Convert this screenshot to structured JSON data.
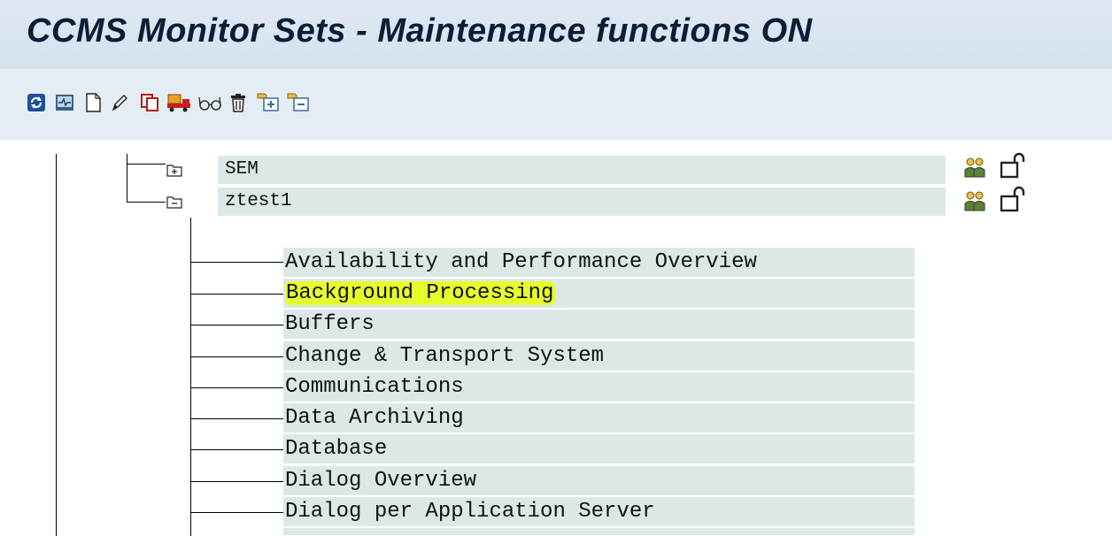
{
  "window": {
    "title": "CCMS Monitor Sets - Maintenance functions ON"
  },
  "toolbar": {
    "buttons": [
      {
        "icon": "refresh-icon"
      },
      {
        "icon": "monitor-icon"
      },
      {
        "icon": "new-document-icon"
      },
      {
        "icon": "pencil-icon"
      },
      {
        "icon": "copy-icon"
      },
      {
        "icon": "transport-truck-icon"
      },
      {
        "icon": "glasses-icon"
      },
      {
        "icon": "trash-icon"
      },
      {
        "icon": "expand-all-icon"
      },
      {
        "icon": "collapse-all-icon"
      }
    ]
  },
  "tree": {
    "monitor_sets": [
      {
        "label": "SEM",
        "state": "collapsed"
      },
      {
        "label": "ztest1",
        "state": "expanded"
      }
    ],
    "monitors": [
      {
        "label": "Availability and Performance Overview"
      },
      {
        "label": "Background Processing",
        "highlighted": true
      },
      {
        "label": "Buffers"
      },
      {
        "label": "Change & Transport System"
      },
      {
        "label": "Communications"
      },
      {
        "label": "Data Archiving"
      },
      {
        "label": "Database"
      },
      {
        "label": "Dialog Overview"
      },
      {
        "label": "Dialog per Application Server"
      }
    ]
  },
  "colors": {
    "title_bg": "#d4e1ee",
    "row_bg": "#dce8e8",
    "highlight": "#e6ff2a"
  }
}
